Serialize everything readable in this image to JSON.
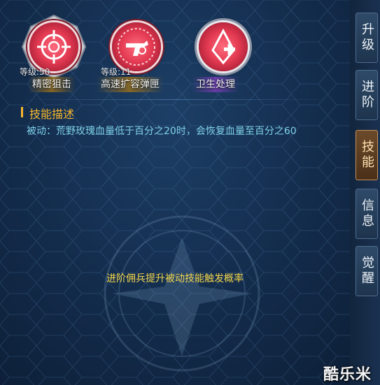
{
  "skills": [
    {
      "name": "精密狙击",
      "level": "等级:50",
      "icon": "crosshair-icon"
    },
    {
      "name": "高速扩容弹匣",
      "level": "等级:11",
      "icon": "revolver-icon"
    },
    {
      "name": "卫生处理",
      "level": "",
      "icon": "medic-icon"
    }
  ],
  "description": {
    "title": "技能描述",
    "text": "被动：荒野玫瑰血量低于百分之20时，会恢复血量至百分之60"
  },
  "hint": "进阶佣兵提升被动技能触发概率",
  "tabs": [
    {
      "label": "升级",
      "active": false
    },
    {
      "label": "进阶",
      "active": false
    },
    {
      "label": "技能",
      "active": true
    },
    {
      "label": "信息",
      "active": false
    },
    {
      "label": "觉醒",
      "active": false
    }
  ],
  "watermark": "酷乐米",
  "colors": {
    "accent_gold": "#f6b62c",
    "desc_text": "#7fd1e8",
    "hint_text": "#f4d64a",
    "skill_red": "#e33a52",
    "tab_active": "#6b4a2a"
  }
}
